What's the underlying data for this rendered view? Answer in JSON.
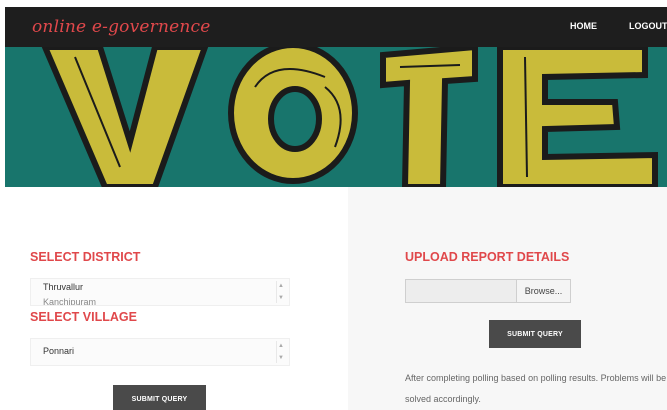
{
  "header": {
    "brand": "online e-governence",
    "nav": {
      "home": "HOME",
      "logout": "LOGOUT"
    }
  },
  "banner": {
    "text": "VOTE",
    "icon": "vote-banner-image"
  },
  "district": {
    "title": "SELECT DISTRICT",
    "selected": "Thruvallur",
    "next_partial": "Kanchipuram"
  },
  "village": {
    "title": "SELECT VILLAGE",
    "selected": "Ponnari"
  },
  "left_submit": "SUBMIT QUERY",
  "report": {
    "title": "UPLOAD REPORT DETAILS",
    "browse_label": "Browse...",
    "submit": "SUBMIT QUERY",
    "info": "After completing polling based on polling results. Problems will be solved accordingly."
  },
  "colors": {
    "accent": "#e0484b",
    "navbar": "#1e1e1e",
    "banner": "#18756c",
    "button": "#4a4a4a"
  }
}
